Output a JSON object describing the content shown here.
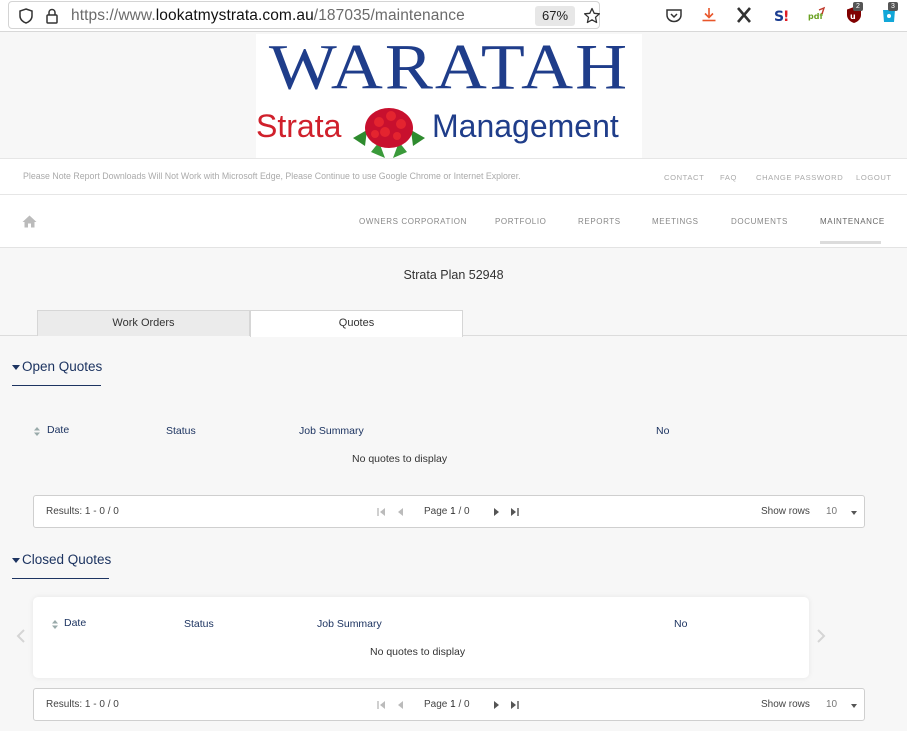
{
  "browser": {
    "url_prefix": "https://www.",
    "url_host": "lookatmystrata.com.au",
    "url_path": "/187035/maintenance",
    "zoom": "67%",
    "ext_badges": [
      "2",
      "3"
    ]
  },
  "logo": {
    "top": "WARATAH",
    "left": "Strata",
    "right": "Management"
  },
  "notice": {
    "text": "Please Note Report Downloads Will Not Work with Microsoft Edge, Please Continue to use Google Chrome or Internet Explorer.",
    "links": [
      "CONTACT",
      "FAQ",
      "CHANGE PASSWORD",
      "LOGOUT"
    ]
  },
  "nav": {
    "items": [
      "OWNERS CORPORATION",
      "PORTFOLIO",
      "REPORTS",
      "MEETINGS",
      "DOCUMENTS",
      "MAINTENANCE"
    ],
    "active": "MAINTENANCE"
  },
  "page": {
    "title": "Strata Plan 52948",
    "tabs": [
      "Work Orders",
      "Quotes"
    ],
    "active_tab": "Quotes"
  },
  "open_quotes": {
    "title": "Open Quotes",
    "columns": [
      "Date",
      "Status",
      "Job Summary",
      "No"
    ],
    "empty": "No quotes to display",
    "pager": {
      "results": "Results: 1 - 0 / 0",
      "page_label": "Page",
      "page_current": "1",
      "page_total": "/ 0",
      "show_rows": "Show rows",
      "rows": "10"
    }
  },
  "closed_quotes": {
    "title": "Closed Quotes",
    "columns": [
      "Date",
      "Status",
      "Job Summary",
      "No"
    ],
    "empty": "No quotes to display",
    "pager": {
      "results": "Results: 1 - 0 / 0",
      "page_label": "Page",
      "page_current": "1",
      "page_total": "/ 0",
      "show_rows": "Show rows",
      "rows": "10"
    }
  },
  "colors": {
    "navy": "#1d3461",
    "logo_blue": "#1f3d8a",
    "logo_red": "#d0202b"
  }
}
